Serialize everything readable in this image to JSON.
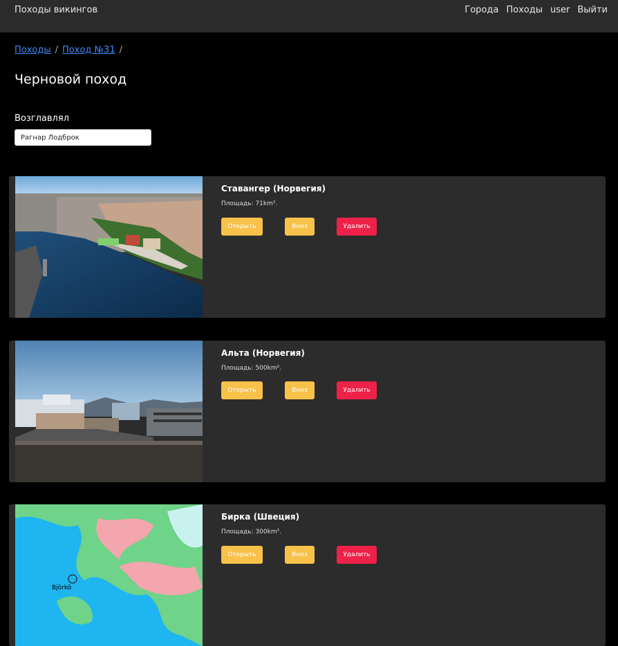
{
  "navbar": {
    "brand": "Походы викингов",
    "links": [
      "Города",
      "Походы",
      "user",
      "Выйти"
    ]
  },
  "breadcrumb": {
    "items": [
      "Походы",
      "Поход №31"
    ],
    "separator": "/"
  },
  "page": {
    "title": "Черновой поход",
    "leader_label": "Возглавлял",
    "leader_value": "Рагнар Лодброк"
  },
  "cards": [
    {
      "city": "Ставангер (Норвегия)",
      "area": "Площадь: 71km².",
      "image_alt": "aerial harbour photo",
      "buttons": {
        "open": "Открыть",
        "down": "Вниз",
        "delete": "Удалить"
      }
    },
    {
      "city": "Альта (Норвегия)",
      "area": "Площадь: 500km².",
      "image_alt": "rooftop town photo",
      "buttons": {
        "open": "Открыть",
        "down": "Вниз",
        "delete": "Удалить"
      }
    },
    {
      "city": "Бирка (Швеция)",
      "area": "Площадь: 300km².",
      "map_label": "Björkö",
      "buttons": {
        "open": "Открыть",
        "down": "Вниз",
        "delete": "Удалить"
      }
    }
  ],
  "colors": {
    "navbar_bg": "#2b2b2b",
    "card_bg": "#2c2c2c",
    "link": "#3d8bfd",
    "warning": "#f8c14a",
    "danger": "#ee2148"
  }
}
